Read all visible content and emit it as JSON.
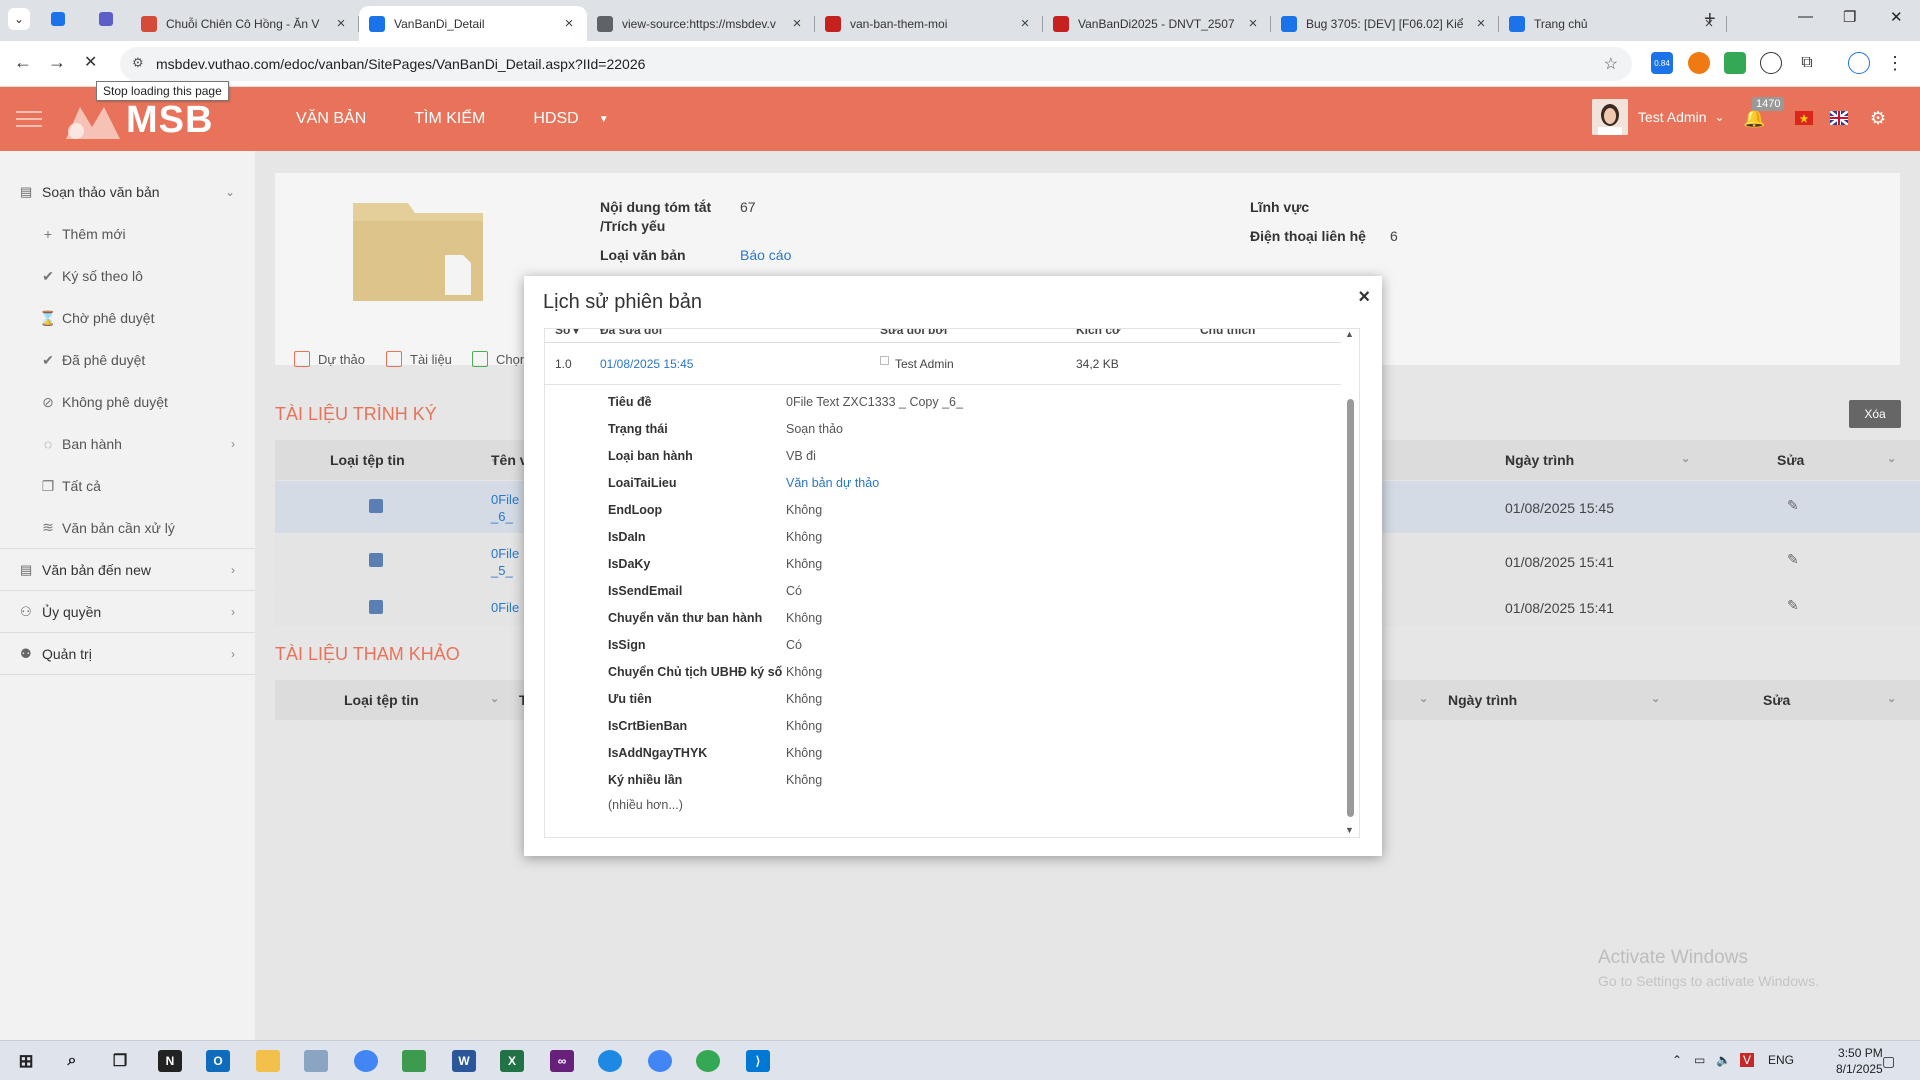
{
  "browser": {
    "tabs": [
      {
        "title": "Chuỗi Chiên Cô Hồng - Ăn V",
        "favicon_color": "#d44b3a",
        "active": false
      },
      {
        "title": "VanBanDi_Detail",
        "favicon_color": "#1a73e8",
        "active": true
      },
      {
        "title": "view-source:https://msbdev.v",
        "favicon_color": "#5f6368",
        "active": false
      },
      {
        "title": "van-ban-them-moi",
        "favicon_color": "#c5221f",
        "active": false
      },
      {
        "title": "VanBanDi2025 - DNVT_2507",
        "favicon_color": "#c5221f",
        "active": false
      },
      {
        "title": "Bug 3705: [DEV] [F06.02] Kiể",
        "favicon_color": "#1a73e8",
        "active": false
      },
      {
        "title": "Trang chủ",
        "favicon_color": "#1a73e8",
        "active": false
      }
    ],
    "url": "msbdev.vuthao.com/edoc/vanban/SitePages/VanBanDi_Detail.aspx?IId=22026",
    "tooltip": "Stop loading this page",
    "ext_badge": "0.84"
  },
  "header": {
    "logo_text": "MSB",
    "menu": [
      "VĂN BẢN",
      "TÌM KIẾM",
      "HDSD"
    ],
    "user_name": "Test Admin",
    "notification_count": "1470"
  },
  "sidebar": {
    "group_draft": "Soạn thảo văn bản",
    "items": [
      {
        "label": "Thêm mới",
        "icon": "plus-icon"
      },
      {
        "label": "Ký số theo lô",
        "icon": "check-circle-icon"
      },
      {
        "label": "Chờ phê duyệt",
        "icon": "hourglass-icon"
      },
      {
        "label": "Đã phê duyệt",
        "icon": "check-circle-icon"
      },
      {
        "label": "Không phê duyệt",
        "icon": "ban-icon"
      },
      {
        "label": "Ban hành",
        "icon": "check-outline-icon"
      },
      {
        "label": "Tất cả",
        "icon": "docs-icon"
      },
      {
        "label": "Văn bản cần xử lý",
        "icon": "layers-icon"
      }
    ],
    "groups": [
      "Văn bản đến new",
      "Ủy quyền",
      "Quản trị"
    ]
  },
  "detail": {
    "summary_label": "Nội dung tóm tắt",
    "summary_label2": "/Trích yếu",
    "summary_value": "67",
    "doctype_label": "Loại văn bản",
    "doctype_value": "Báo cáo",
    "field_label": "Lĩnh vực",
    "phone_label": "Điện thoại liên hệ",
    "phone_value": "6",
    "toolbar": [
      "Dự thảo",
      "Tài liệu",
      "Chọn"
    ]
  },
  "sign_docs": {
    "title": "TÀI LIỆU TRÌNH KÝ",
    "delete_label": "Xóa",
    "headers": [
      "Loại tệp tin",
      "Tên v",
      "Ngày trình",
      "Sửa"
    ],
    "rows": [
      {
        "name1": "0File",
        "name2": "_6_",
        "date": "01/08/2025 15:45"
      },
      {
        "name1": "0File",
        "name2": "_5_",
        "date": "01/08/2025 15:41"
      },
      {
        "name1": "0File",
        "name2": "",
        "date": "01/08/2025 15:41"
      }
    ]
  },
  "ref_docs": {
    "title": "TÀI LIỆU THAM KHẢO",
    "headers": [
      "Loại tệp tin",
      "T",
      "Ngày trình",
      "Sửa"
    ]
  },
  "modal": {
    "title": "Lịch sử phiên bản",
    "columns": [
      "Số",
      "Đã sửa đổi",
      "Sửa đổi bởi",
      "Kích cỡ",
      "Chú thích"
    ],
    "version": {
      "no": "1.0",
      "modified": "01/08/2025 15:45",
      "by": "Test Admin",
      "size": "34,2 KB"
    },
    "properties": [
      {
        "k": "Tiêu đề",
        "v": "0File Text ZXC1333 _ Copy _6_"
      },
      {
        "k": "Trạng thái",
        "v": "Soạn thảo"
      },
      {
        "k": "Loại ban hành",
        "v": "VB đi"
      },
      {
        "k": "LoaiTaiLieu",
        "v": "Văn bản dự thảo",
        "link": true
      },
      {
        "k": "EndLoop",
        "v": "Không"
      },
      {
        "k": "IsDaIn",
        "v": "Không"
      },
      {
        "k": "IsDaKy",
        "v": "Không"
      },
      {
        "k": "IsSendEmail",
        "v": "Có"
      },
      {
        "k": "Chuyển văn thư ban hành",
        "v": "Không"
      },
      {
        "k": "IsSign",
        "v": "Có"
      },
      {
        "k": "Chuyển Chủ tịch UBHĐ ký số",
        "v": "Không"
      },
      {
        "k": "Ưu tiên",
        "v": "Không"
      },
      {
        "k": "IsCrtBienBan",
        "v": "Không"
      },
      {
        "k": "IsAddNgayTHYK",
        "v": "Không"
      },
      {
        "k": "Ký nhiều lần",
        "v": "Không"
      }
    ],
    "more": "(nhiều hơn...)"
  },
  "watermark": {
    "line1": "Activate Windows",
    "line2": "Go to Settings to activate Windows."
  },
  "taskbar": {
    "lang": "ENG",
    "time": "3:50 PM",
    "date": "8/1/2025"
  }
}
